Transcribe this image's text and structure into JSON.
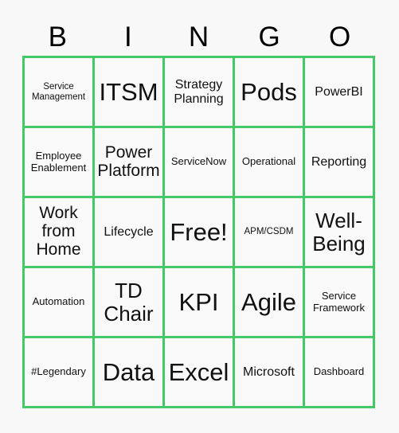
{
  "card": {
    "title": "BINGO Card",
    "background_color": "#f8f8f8",
    "grid_border_color": "#45c866",
    "text_color": "#111111"
  },
  "header": {
    "letters": [
      {
        "label": "B"
      },
      {
        "label": "I"
      },
      {
        "label": "N"
      },
      {
        "label": "G"
      },
      {
        "label": "O"
      }
    ]
  },
  "grid": {
    "columns": 5,
    "rows": 5,
    "free_space": {
      "row": 2,
      "col": 2,
      "label": "Free!"
    },
    "cells": [
      [
        {
          "label": "Service Management",
          "size": "xs"
        },
        {
          "label": "ITSM",
          "size": "xxl"
        },
        {
          "label": "Strategy Planning",
          "size": "md"
        },
        {
          "label": "Pods",
          "size": "xxl"
        },
        {
          "label": "PowerBI",
          "size": "md"
        }
      ],
      [
        {
          "label": "Employee Enablement",
          "size": "sm"
        },
        {
          "label": "Power Platform",
          "size": "lg"
        },
        {
          "label": "ServiceNow",
          "size": "sm"
        },
        {
          "label": "Operational",
          "size": "sm"
        },
        {
          "label": "Reporting",
          "size": "md"
        }
      ],
      [
        {
          "label": "Work from Home",
          "size": "lg"
        },
        {
          "label": "Lifecycle",
          "size": "md"
        },
        {
          "label": "Free!",
          "size": "xxl"
        },
        {
          "label": "APM/CSDM",
          "size": "xs"
        },
        {
          "label": "Well-Being",
          "size": "xl"
        }
      ],
      [
        {
          "label": "Automation",
          "size": "sm"
        },
        {
          "label": "TD Chair",
          "size": "xl"
        },
        {
          "label": "KPI",
          "size": "xxl"
        },
        {
          "label": "Agile",
          "size": "xxl"
        },
        {
          "label": "Service Framework",
          "size": "sm"
        }
      ],
      [
        {
          "label": "#Legendary",
          "size": "sm"
        },
        {
          "label": "Data",
          "size": "xxl"
        },
        {
          "label": "Excel",
          "size": "xxl"
        },
        {
          "label": "Microsoft",
          "size": "md"
        },
        {
          "label": "Dashboard",
          "size": "sm"
        }
      ]
    ]
  }
}
